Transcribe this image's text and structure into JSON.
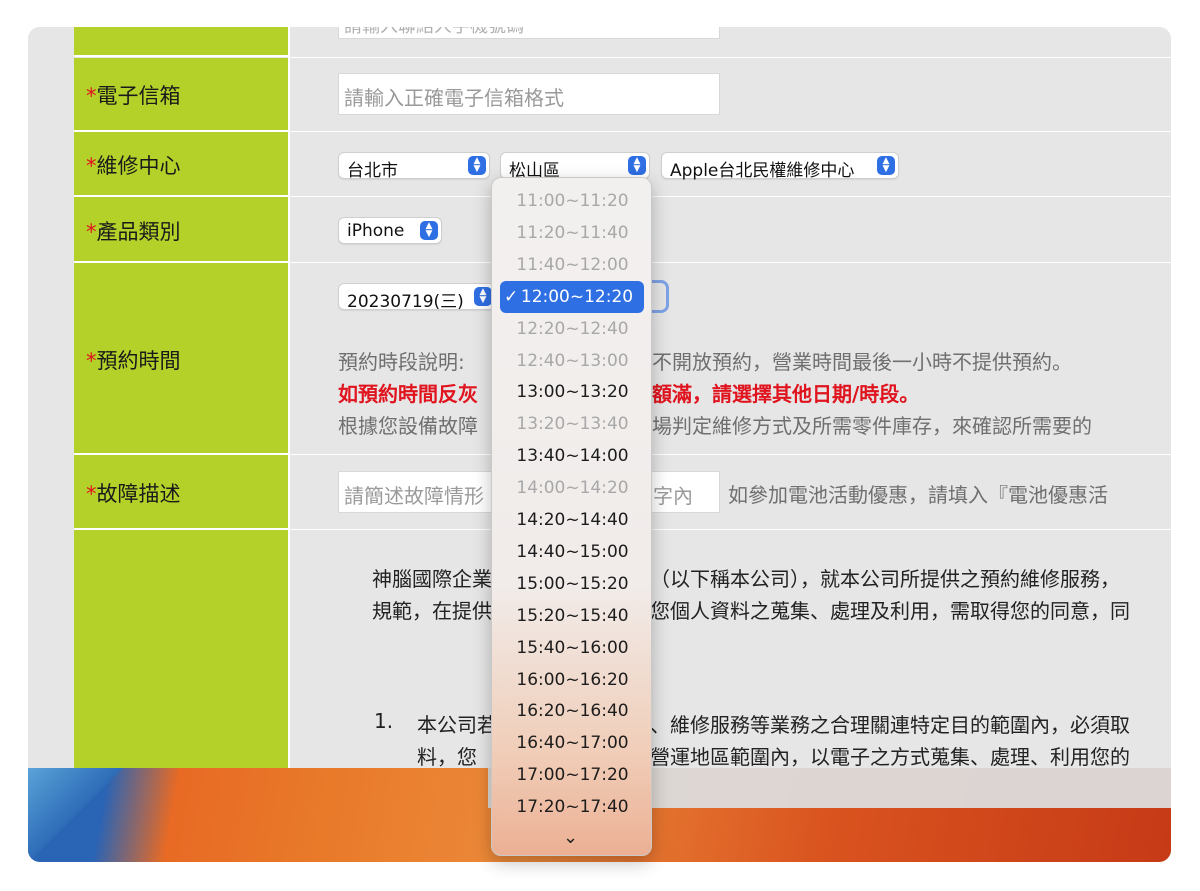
{
  "form": {
    "top_input_partial": "請輸入聯絡人手機號碼",
    "email": {
      "label": "電子信箱",
      "placeholder": "請輸入正確電子信箱格式"
    },
    "service_center": {
      "label": "維修中心",
      "city": "台北市",
      "district": "松山區",
      "center": "Apple台北民權維修中心"
    },
    "product": {
      "label": "產品類別",
      "value": "iPhone"
    },
    "appointment": {
      "label": "預約時間",
      "date": "20230719(三)",
      "note_gray_1": "預約時段說明:",
      "note_gray_1_tail": "不開放預約，營業時間最後一小時不提供預約。",
      "note_red_head": "如預約時間反灰",
      "note_red_tail": "額滿，請選擇其他日期/時段。",
      "note_gray_2_head": "根據您設備故障",
      "note_gray_2_tail": "場判定維修方式及所需零件庫存，來確認所需要的"
    },
    "fault": {
      "label": "故障描述",
      "placeholder_head": "請簡述故障情形",
      "placeholder_tail": "字內",
      "note": "如參加電池活動優惠，請填入『電池優惠活"
    },
    "privacy": {
      "line1_head": "神腦國際企業",
      "line1_tail": "（以下稱本公司），就本公司所提供之預約維修服務，",
      "line2_head": "規範，在提供",
      "line2_tail": "您個人資料之蒐集、處理及利用，需取得您的同意，同",
      "item_num": "1.",
      "item1_head": "本公司若",
      "item1_tail": "、維修服務等業務之合理關連特定目的範圍內，必須取",
      "item2_head": "料，您",
      "item2_tail": "營運地區範圍內，以電子之方式蒐集、處理、利用您的"
    }
  },
  "time_dropdown": {
    "selected": "12:00~12:20",
    "options": [
      {
        "label": "11:00~11:20",
        "state": "disabled"
      },
      {
        "label": "11:20~11:40",
        "state": "disabled"
      },
      {
        "label": "11:40~12:00",
        "state": "disabled"
      },
      {
        "label": "12:00~12:20",
        "state": "selected"
      },
      {
        "label": "12:20~12:40",
        "state": "disabled"
      },
      {
        "label": "12:40~13:00",
        "state": "disabled"
      },
      {
        "label": "13:00~13:20",
        "state": "enabled"
      },
      {
        "label": "13:20~13:40",
        "state": "disabled"
      },
      {
        "label": "13:40~14:00",
        "state": "enabled"
      },
      {
        "label": "14:00~14:20",
        "state": "disabled"
      },
      {
        "label": "14:20~14:40",
        "state": "enabled"
      },
      {
        "label": "14:40~15:00",
        "state": "enabled"
      },
      {
        "label": "15:00~15:20",
        "state": "enabled"
      },
      {
        "label": "15:20~15:40",
        "state": "enabled"
      },
      {
        "label": "15:40~16:00",
        "state": "enabled"
      },
      {
        "label": "16:00~16:20",
        "state": "enabled"
      },
      {
        "label": "16:20~16:40",
        "state": "enabled"
      },
      {
        "label": "16:40~17:00",
        "state": "enabled"
      },
      {
        "label": "17:00~17:20",
        "state": "enabled"
      },
      {
        "label": "17:20~17:40",
        "state": "enabled"
      }
    ],
    "check_icon": "checkmark-icon",
    "more_icon": "chevron-down-icon"
  },
  "colors": {
    "label_bg": "#b4d12a",
    "required": "#e0141e",
    "accent": "#2f6fe4"
  }
}
